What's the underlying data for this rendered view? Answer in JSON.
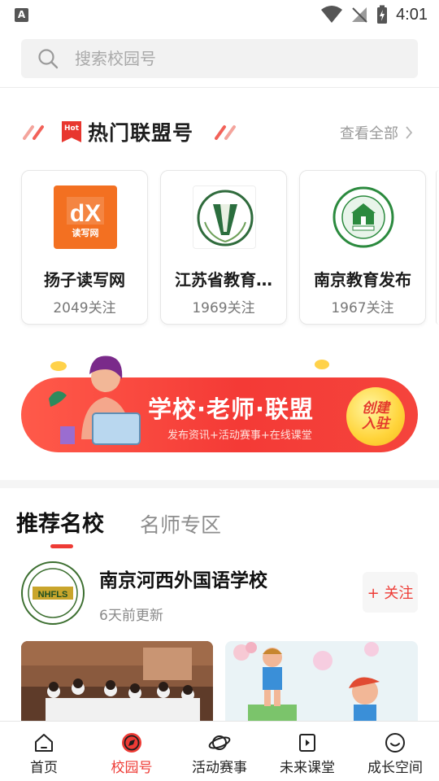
{
  "status_bar": {
    "time": "4:01",
    "app_glyph": "A"
  },
  "search": {
    "placeholder": "搜索校园号"
  },
  "hot_section": {
    "badge": "Hot",
    "title": "热门联盟号",
    "view_all": "查看全部"
  },
  "cards": [
    {
      "name": "扬子读写网",
      "followers": "2049关注",
      "logo_text": "读写网",
      "logo_mark": "dX"
    },
    {
      "name": "江苏省教育…",
      "followers": "1969关注"
    },
    {
      "name": "南京教育发布",
      "followers": "1967关注"
    }
  ],
  "banner": {
    "title": "学校·老师·联盟",
    "subtitle": "发布资讯+活动赛事+在线课堂",
    "cta_line1": "创建",
    "cta_line2": "入驻"
  },
  "tabs": [
    {
      "label": "推荐名校",
      "active": true
    },
    {
      "label": "名师专区",
      "active": false
    }
  ],
  "school": {
    "name": "南京河西外国语学校",
    "update": "6天前更新",
    "follow_label": "+ 关注",
    "logo_text": "NHFLS"
  },
  "bottom_nav": [
    {
      "label": "首页",
      "icon": "home-icon",
      "active": false
    },
    {
      "label": "校园号",
      "icon": "compass-icon",
      "active": true
    },
    {
      "label": "活动赛事",
      "icon": "planet-icon",
      "active": false
    },
    {
      "label": "未来课堂",
      "icon": "play-book-icon",
      "active": false
    },
    {
      "label": "成长空间",
      "icon": "smile-icon",
      "active": false
    }
  ],
  "colors": {
    "accent": "#ee3b35",
    "banner_gradient_start": "#ff5a4a",
    "banner_gradient_end": "#f43a36",
    "cta_yellow": "#ffd43a",
    "logo_orange": "#f37021",
    "logo_green": "#2b8a3e"
  }
}
